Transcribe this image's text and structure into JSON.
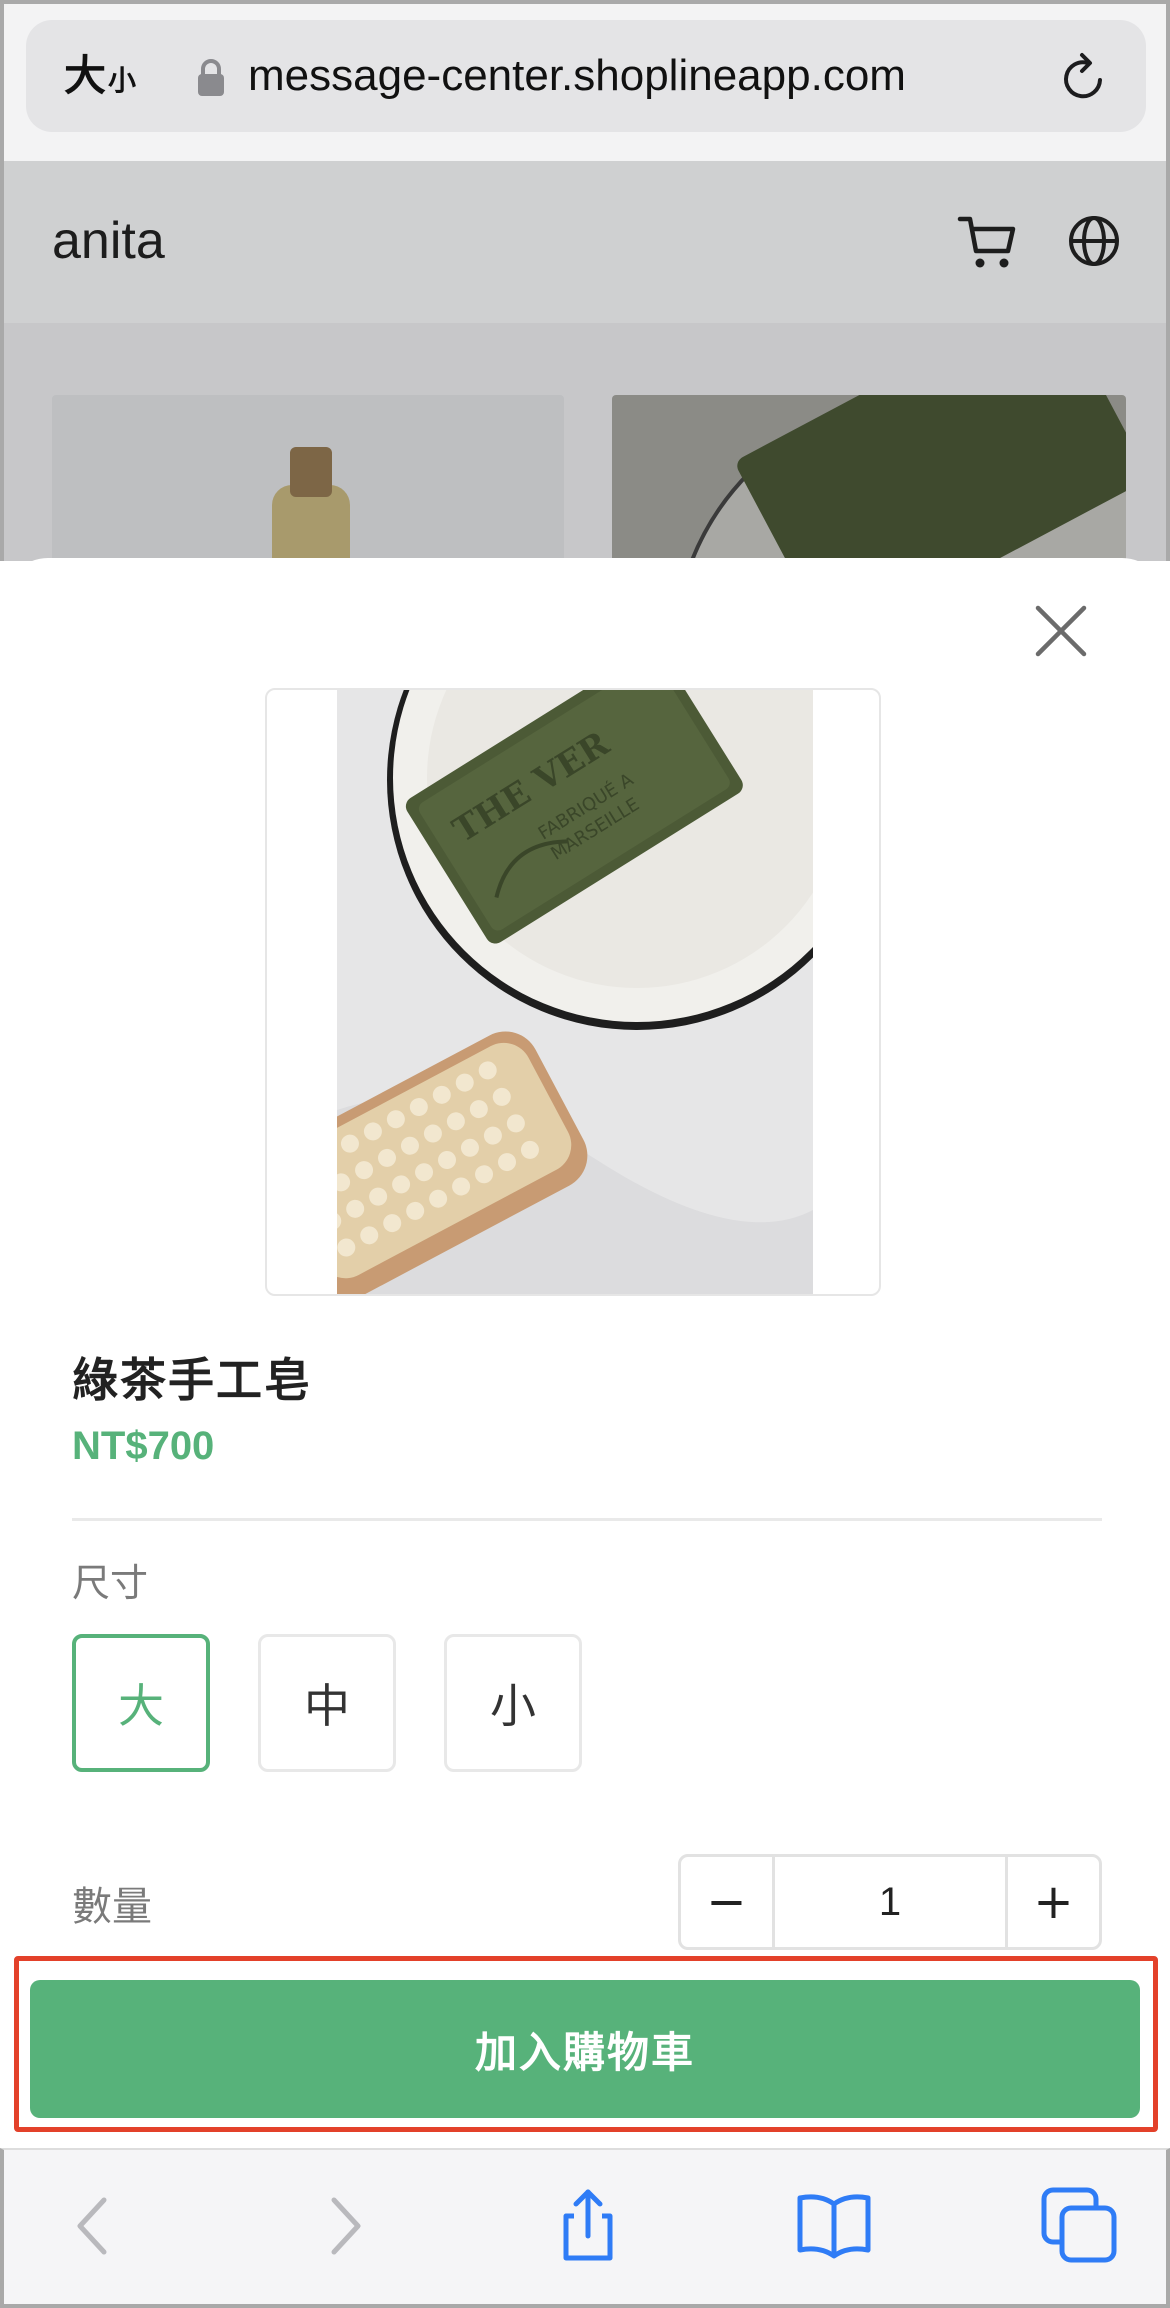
{
  "browser": {
    "text_size_label_big": "大",
    "text_size_label_small": "小",
    "url": "message-center.shoplineapp.com"
  },
  "site": {
    "logo": "anita",
    "icons": [
      "cart-icon",
      "globe-icon"
    ]
  },
  "product": {
    "name": "綠茶手工皂",
    "price": "NT$700",
    "option_label": "尺寸",
    "sizes": [
      "大",
      "中",
      "小"
    ],
    "selected_size": "大",
    "quantity_label": "數量",
    "quantity": "1",
    "minus_label": "−",
    "plus_label": "+"
  },
  "actions": {
    "add_to_cart": "加入購物車"
  },
  "colors": {
    "accent_green": "#57b27a",
    "highlight_red": "#e3412a",
    "ios_blue": "#2f7cf6"
  }
}
